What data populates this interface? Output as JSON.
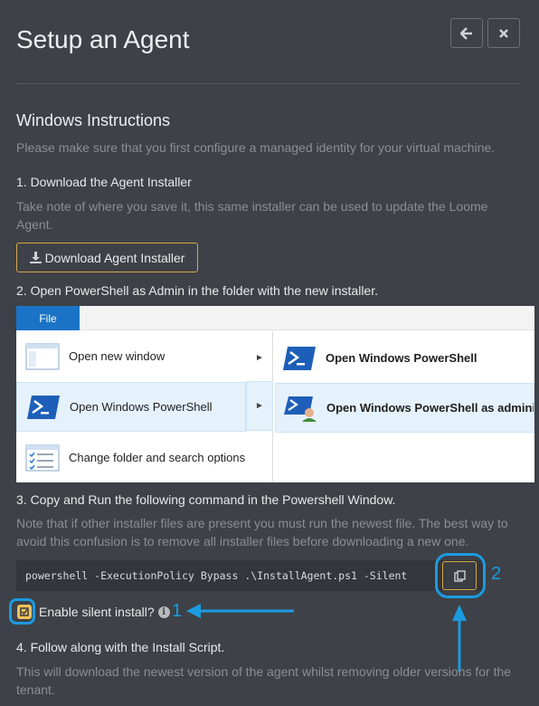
{
  "header": {
    "title": "Setup an Agent",
    "back_icon": "arrow-left-icon",
    "close_icon": "close-icon"
  },
  "section": {
    "title": "Windows Instructions",
    "intro": "Please make sure that you first configure a managed identity for your virtual machine."
  },
  "step1": {
    "heading": "1. Download the Agent Installer",
    "note": "Take note of where you save it, this same installer can be used to update the Loome Agent.",
    "button_label": "Download Agent Installer"
  },
  "step2": {
    "heading": "2. Open PowerShell as Admin in the folder with the new installer.",
    "explorer": {
      "file_tab": "File",
      "menu": [
        "Open new window",
        "Open Windows PowerShell",
        "Change folder and search options"
      ],
      "submenu": [
        "Open Windows PowerShell",
        "Open Windows PowerShell as administrator"
      ]
    }
  },
  "step3": {
    "heading": "3. Copy and Run the following command in the Powershell Window.",
    "note": "Note that if other installer files are present you must run the newest file. The best way to avoid this confusion is to remove all installer files before downloading a new one.",
    "command": "powershell -ExecutionPolicy Bypass .\\InstallAgent.ps1 -Silent",
    "silent_label": "Enable silent install?",
    "silent_checked": true
  },
  "step4": {
    "heading": "4. Follow along with the Install Script.",
    "note": "This will download the newest version of the agent whilst removing older versions for the tenant."
  },
  "callouts": {
    "one": "1",
    "two": "2"
  },
  "colors": {
    "accent": "#d8a84a",
    "callout": "#1b9be0",
    "background": "#3e4147"
  }
}
